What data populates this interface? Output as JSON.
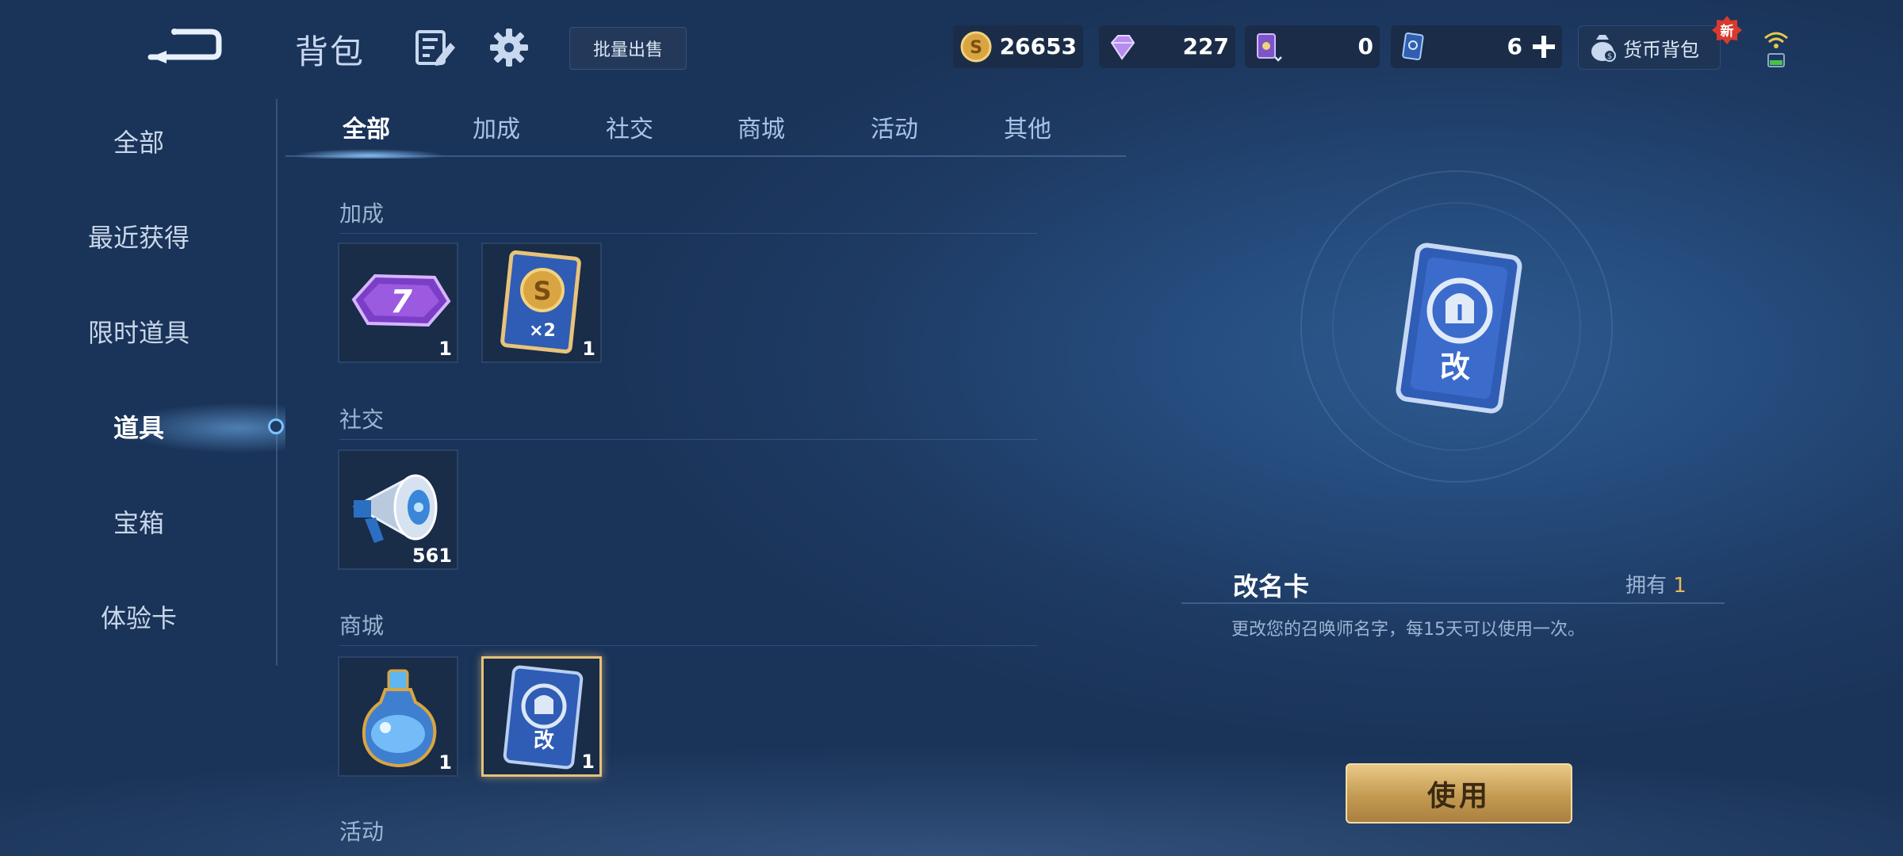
{
  "header": {
    "title": "背包",
    "bulk_sell_label": "批量出售",
    "currencies": [
      {
        "icon": "gold-coin-icon",
        "value": "26653"
      },
      {
        "icon": "diamond-icon",
        "value": "227"
      },
      {
        "icon": "purple-ticket-icon",
        "value": "0"
      },
      {
        "icon": "blue-card-icon",
        "value": "6"
      }
    ],
    "wallet_label": "货币背包",
    "new_badge": "新"
  },
  "sidebar": {
    "items": [
      {
        "label": "全部"
      },
      {
        "label": "最近获得"
      },
      {
        "label": "限时道具"
      },
      {
        "label": "道具"
      },
      {
        "label": "宝箱"
      },
      {
        "label": "体验卡"
      }
    ],
    "active": "道具"
  },
  "tabs": {
    "items": [
      {
        "label": "全部"
      },
      {
        "label": "加成"
      },
      {
        "label": "社交"
      },
      {
        "label": "商城"
      },
      {
        "label": "活动"
      },
      {
        "label": "其他"
      }
    ],
    "active": "全部"
  },
  "sections": {
    "buff": {
      "title": "加成",
      "items": [
        {
          "icon": "exp-card-7day-icon",
          "count": "1"
        },
        {
          "icon": "gold-double-card-icon",
          "count": "1"
        }
      ]
    },
    "social": {
      "title": "社交",
      "items": [
        {
          "icon": "megaphone-icon",
          "count": "561"
        }
      ]
    },
    "shop": {
      "title": "商城",
      "items": [
        {
          "icon": "potion-bottle-icon",
          "count": "1"
        },
        {
          "icon": "rename-card-icon",
          "count": "1"
        }
      ]
    },
    "event": {
      "title": "活动"
    }
  },
  "detail": {
    "name": "改名卡",
    "own_label": "拥有",
    "own_count": "1",
    "description": "更改您的召唤师名字，每15天可以使用一次。",
    "use_button": "使用"
  },
  "colors": {
    "accent_gold": "#e6c27a",
    "background": "#254c7d"
  }
}
